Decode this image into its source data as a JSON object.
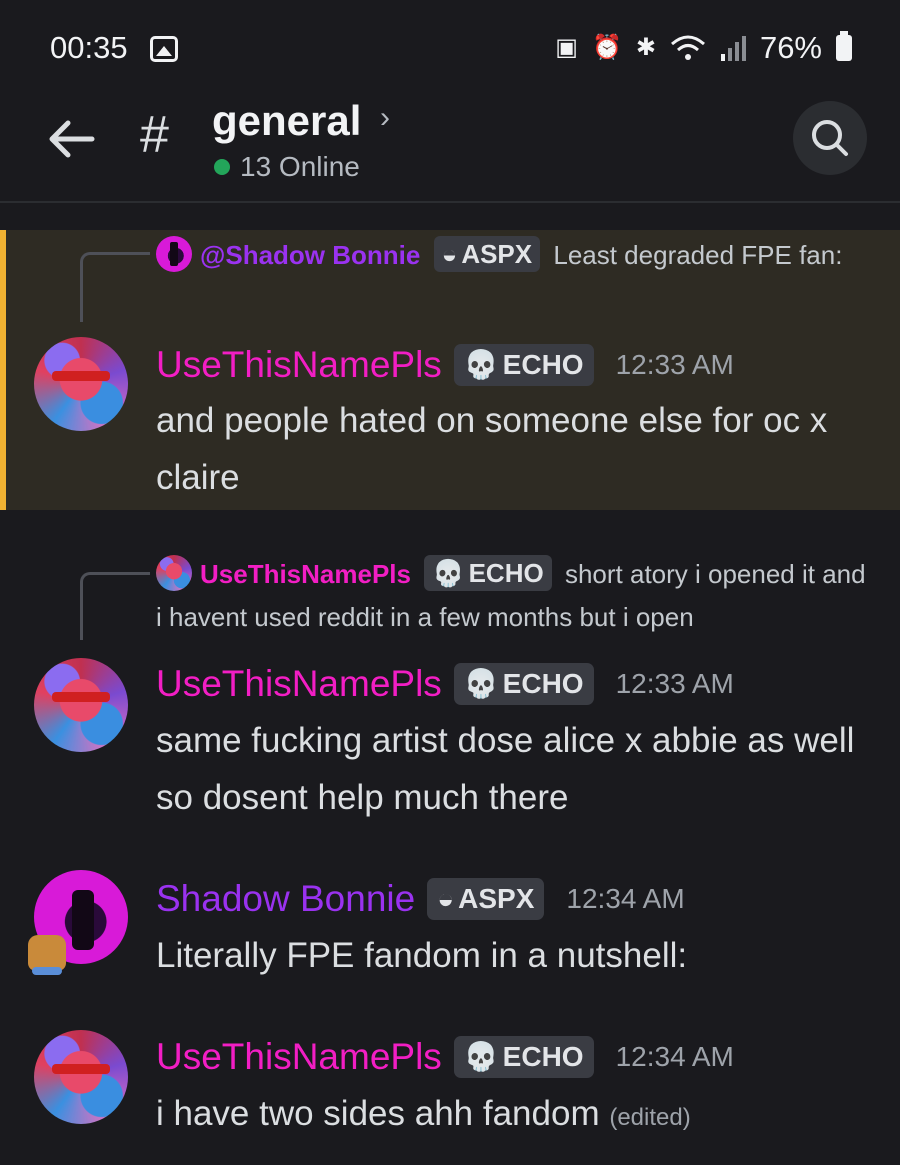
{
  "status_bar": {
    "time": "00:35",
    "battery": "76%",
    "icons": [
      "gallery-icon",
      "nfc-icon",
      "alarm-icon",
      "bluetooth-icon",
      "wifi-icon",
      "signal-icon",
      "battery-icon"
    ]
  },
  "header": {
    "channel": "general",
    "online": "13 Online",
    "hash": "#",
    "chevron": "›"
  },
  "colors": {
    "accent_pink": "#f21ec4",
    "accent_purple": "#9a32f0",
    "online_green": "#23a55a",
    "mention_bar": "#f0b232"
  },
  "messages": [
    {
      "reply": {
        "name": "@Shadow Bonnie",
        "tag_icon": "◒",
        "tag": "ASPX",
        "preview": "Least degraded FPE fan:"
      },
      "author": "UseThisNamePls",
      "tag_icon": "💀",
      "tag": "ECHO",
      "time": "12:33 AM",
      "text": "and people hated on someone else for oc x claire"
    },
    {
      "reply": {
        "name": "UseThisNamePls",
        "tag_icon": "💀",
        "tag": "ECHO",
        "preview": "short atory i opened it and i havent used reddit in a few months but i open"
      },
      "author": "UseThisNamePls",
      "tag_icon": "💀",
      "tag": "ECHO",
      "time": "12:33 AM",
      "text": "same fucking artist dose alice x abbie as well so dosent help much there"
    },
    {
      "author": "Shadow Bonnie",
      "tag_icon": "◒",
      "tag": "ASPX",
      "time": "12:34 AM",
      "text": "Literally FPE fandom in a nutshell:"
    },
    {
      "author": "UseThisNamePls",
      "tag_icon": "💀",
      "tag": "ECHO",
      "time": "12:34 AM",
      "text": "i have two sides ahh fandom",
      "edited": "(edited)"
    }
  ]
}
